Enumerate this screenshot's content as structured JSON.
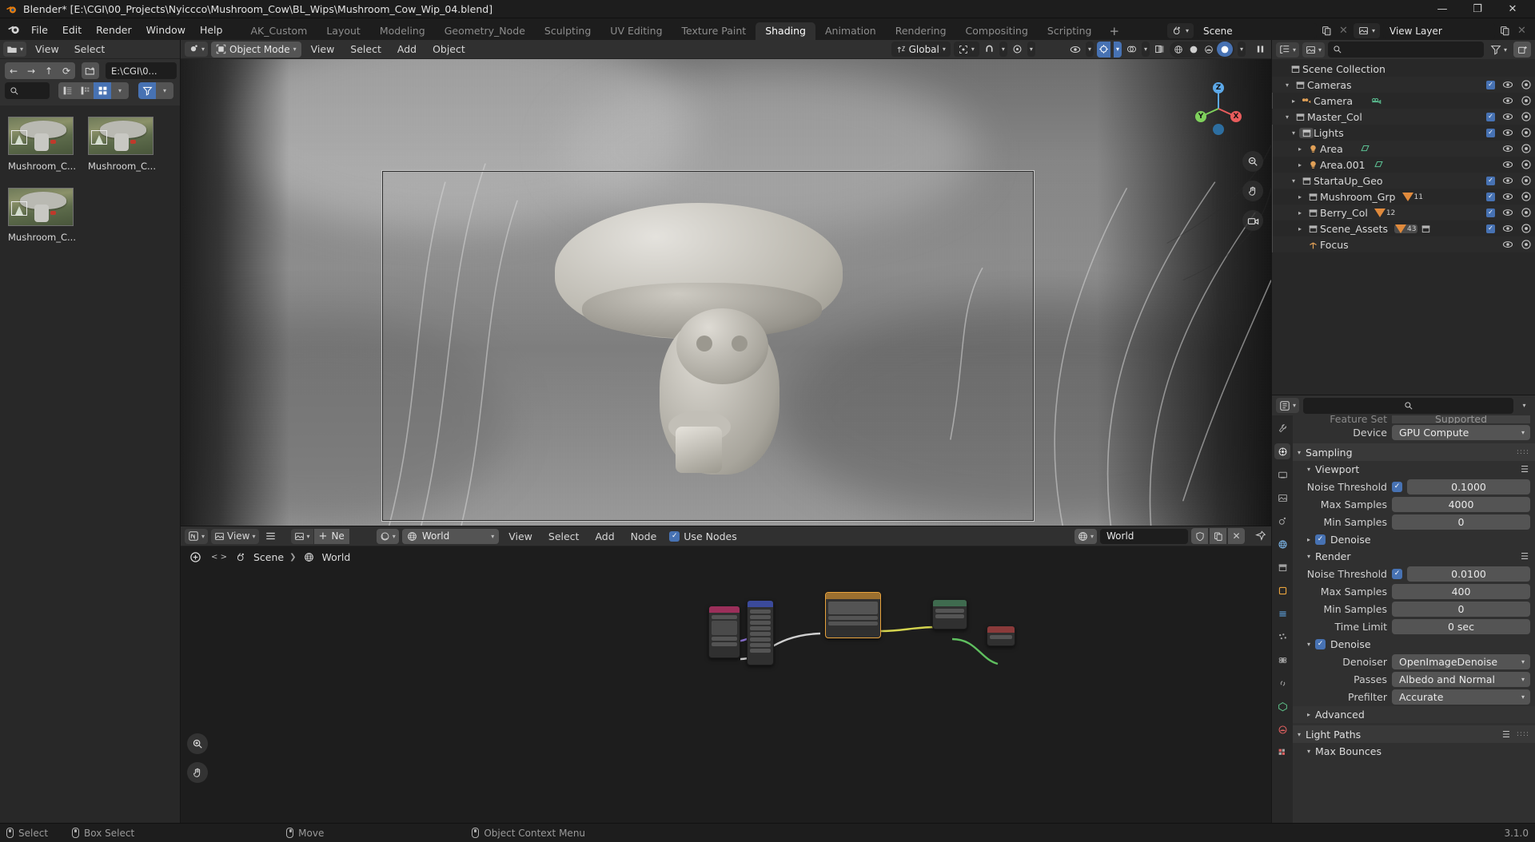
{
  "window": {
    "title": "Blender* [E:\\CGI\\00_Projects\\Nyiccco\\Mushroom_Cow\\BL_Wips\\Mushroom_Cow_Wip_04.blend]",
    "minimize": "—",
    "maximize": "❐",
    "close": "✕"
  },
  "topbar": {
    "menus": [
      "File",
      "Edit",
      "Render",
      "Window",
      "Help"
    ],
    "workspaces": [
      {
        "label": "AK_Custom",
        "active": false
      },
      {
        "label": "Layout",
        "active": false
      },
      {
        "label": "Modeling",
        "active": false
      },
      {
        "label": "Geometry_Node",
        "active": false
      },
      {
        "label": "Sculpting",
        "active": false
      },
      {
        "label": "UV Editing",
        "active": false
      },
      {
        "label": "Texture Paint",
        "active": false
      },
      {
        "label": "Shading",
        "active": true
      },
      {
        "label": "Animation",
        "active": false
      },
      {
        "label": "Rendering",
        "active": false
      },
      {
        "label": "Compositing",
        "active": false
      },
      {
        "label": "Scripting",
        "active": false
      }
    ],
    "add_workspace": "+",
    "scene_label": "Scene",
    "viewlayer_label": "View Layer"
  },
  "filebrowser": {
    "menus": [
      "View",
      "Select"
    ],
    "nav": {
      "back": "←",
      "forward": "→",
      "up": "↑",
      "refresh": "⟳",
      "newfolder": "+"
    },
    "path": "E:\\CGI\\0...",
    "search_placeholder": "",
    "display_modes": [
      "vertical-list",
      "horizontal-list",
      "thumbnail-grid"
    ],
    "active_display_mode": "thumbnail-grid",
    "filter_enabled": true,
    "assets": [
      {
        "label": "Mushroom_C..."
      },
      {
        "label": "Mushroom_C..."
      },
      {
        "label": "Mushroom_C..."
      }
    ]
  },
  "viewport": {
    "mode": "Object Mode",
    "menus": [
      "View",
      "Select",
      "Add",
      "Object"
    ],
    "transform_orientation": "Global",
    "gizmo_axes": [
      "X",
      "Y",
      "Z"
    ],
    "overlay_icons": [
      "snap-magnet-icon",
      "proportional-edit-icon",
      "visibility-icon",
      "gizmo-icon",
      "overlays-icon",
      "xray-icon"
    ],
    "shading_modes": [
      "wireframe",
      "solid",
      "material-preview",
      "rendered"
    ],
    "active_shading_mode": "rendered"
  },
  "outliner": {
    "search_placeholder": "",
    "rows": [
      {
        "name": "Scene Collection",
        "indent": 0,
        "icon": "collection-icon",
        "tri": "",
        "checkbox": false,
        "eye": false,
        "camera": false
      },
      {
        "name": "Cameras",
        "indent": 1,
        "icon": "collection-icon",
        "tri": "▾",
        "checkbox": true,
        "eye": true,
        "camera": true
      },
      {
        "name": "Camera",
        "indent": 2,
        "icon": "camera-icon",
        "tri": "▸",
        "checkbox": false,
        "eye": true,
        "camera": true,
        "data_icon": "camera-data-icon"
      },
      {
        "name": "Master_Col",
        "indent": 1,
        "icon": "collection-icon",
        "tri": "▾",
        "checkbox": true,
        "eye": true,
        "camera": true
      },
      {
        "name": "Lights",
        "indent": 2,
        "icon": "collection-icon",
        "tri": "▾",
        "checkbox": true,
        "eye": true,
        "camera": true
      },
      {
        "name": "Area",
        "indent": 3,
        "icon": "light-icon",
        "tri": "▸",
        "checkbox": false,
        "eye": true,
        "camera": true,
        "data_icon": "light-data-icon"
      },
      {
        "name": "Area.001",
        "indent": 3,
        "icon": "light-icon",
        "tri": "▸",
        "checkbox": false,
        "eye": true,
        "camera": true,
        "data_icon": "light-data-icon"
      },
      {
        "name": "StartaUp_Geo",
        "indent": 2,
        "icon": "collection-icon",
        "tri": "▾",
        "checkbox": true,
        "eye": true,
        "camera": true
      },
      {
        "name": "Mushroom_Grp",
        "indent": 3,
        "icon": "collection-icon",
        "tri": "▸",
        "checkbox": true,
        "eye": true,
        "camera": true,
        "badge": "11"
      },
      {
        "name": "Berry_Col",
        "indent": 3,
        "icon": "collection-icon",
        "tri": "▸",
        "checkbox": true,
        "eye": true,
        "camera": true,
        "badge": "12"
      },
      {
        "name": "Scene_Assets",
        "indent": 3,
        "icon": "collection-icon",
        "tri": "▸",
        "checkbox": true,
        "eye": true,
        "camera": true,
        "badge": "43",
        "extra_icon": "collection-icon"
      },
      {
        "name": "Focus",
        "indent": 3,
        "icon": "empty-icon",
        "tri": "",
        "checkbox": false,
        "eye": true,
        "camera": true
      }
    ]
  },
  "properties": {
    "search_placeholder": "",
    "tabs": [
      "tool-icon",
      "render-icon",
      "output-icon",
      "viewlayer-icon",
      "scene-icon",
      "world-icon",
      "collection-icon",
      "object-icon",
      "modifier-icon",
      "particles-icon",
      "physics-icon",
      "constraints-icon",
      "data-icon",
      "material-icon",
      "texture-icon"
    ],
    "active_tab_index": 1,
    "rows": [
      {
        "type": "field",
        "label": "Feature Set",
        "value": "Supported",
        "clipped": true
      },
      {
        "type": "field",
        "label": "Device",
        "value": "GPU Compute",
        "dropdown": true
      }
    ],
    "sampling": {
      "title": "Sampling",
      "viewport": {
        "title": "Viewport",
        "noise_threshold_label": "Noise Threshold",
        "noise_threshold_enabled": true,
        "noise_threshold": "0.1000",
        "max_samples_label": "Max Samples",
        "max_samples": "4000",
        "min_samples_label": "Min Samples",
        "min_samples": "0",
        "denoise_label": "Denoise",
        "denoise_enabled": true
      },
      "render": {
        "title": "Render",
        "noise_threshold_label": "Noise Threshold",
        "noise_threshold_enabled": true,
        "noise_threshold": "0.0100",
        "max_samples_label": "Max Samples",
        "max_samples": "400",
        "min_samples_label": "Min Samples",
        "min_samples": "0",
        "time_limit_label": "Time Limit",
        "time_limit": "0 sec",
        "denoise_label": "Denoise",
        "denoise_enabled": true,
        "denoiser_label": "Denoiser",
        "denoiser": "OpenImageDenoise",
        "passes_label": "Passes",
        "passes": "Albedo and Normal",
        "prefilter_label": "Prefilter",
        "prefilter": "Accurate",
        "advanced_label": "Advanced"
      }
    },
    "light_paths": {
      "title": "Light Paths",
      "max_bounces_label": "Max Bounces"
    }
  },
  "shader_editor": {
    "menus": [
      "View",
      "Select",
      "Add",
      "Node"
    ],
    "shader_type": "World",
    "datablock": "World",
    "use_nodes_label": "Use Nodes",
    "use_nodes_enabled": true,
    "new_button": "Ne",
    "breadcrumb": [
      "Scene",
      "World"
    ],
    "breadcrumb_sep": "❯"
  },
  "statusbar": {
    "items": [
      {
        "icon": "mouse-left-icon",
        "label": "Select"
      },
      {
        "icon": "mouse-left-drag-icon",
        "label": "Box Select"
      },
      {
        "icon": "mouse-middle-icon",
        "label": "Move"
      },
      {
        "icon": "mouse-right-icon",
        "label": "Object Context Menu"
      }
    ],
    "version": "3.1.0"
  },
  "colors": {
    "accent_blue": "#4772b3",
    "orange": "#e08a3c",
    "panel_bg": "#303030",
    "dark_bg": "#1d1d1d",
    "mid_bg": "#282828",
    "widget": "#545454"
  }
}
